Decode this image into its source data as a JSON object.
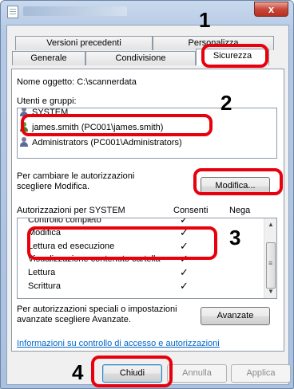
{
  "window": {
    "close_glyph": "x"
  },
  "tabs": {
    "back": [
      {
        "label": "Versioni precedenti"
      },
      {
        "label": "Personalizza"
      }
    ],
    "front": [
      {
        "label": "Generale"
      },
      {
        "label": "Condivisione"
      },
      {
        "label": "Sicurezza"
      }
    ]
  },
  "object_name": {
    "label": "Nome oggetto:",
    "value": "C:\\scannerdata"
  },
  "users_groups": {
    "label": "Utenti e gruppi:",
    "items": [
      {
        "label": "SYSTEM"
      },
      {
        "label": "james.smith (PC001\\james.smith)"
      },
      {
        "label": "Administrators (PC001\\Administrators)"
      }
    ]
  },
  "change_hint": {
    "line1": "Per cambiare le autorizzazioni",
    "line2": "scegliere Modifica."
  },
  "modify_button": "Modifica...",
  "permissions": {
    "header": "Autorizzazioni per SYSTEM",
    "allow_col": "Consenti",
    "deny_col": "Nega",
    "rows": [
      {
        "name": "Controllo completo",
        "allow": "✓"
      },
      {
        "name": "Modifica",
        "allow": "✓"
      },
      {
        "name": "Lettura ed esecuzione",
        "allow": "✓"
      },
      {
        "name": "Visualizzazione contenuto cartella",
        "allow": "✓"
      },
      {
        "name": "Lettura",
        "allow": "✓"
      },
      {
        "name": "Scrittura",
        "allow": "✓"
      }
    ]
  },
  "special_hint": {
    "line1": "Per autorizzazioni speciali o impostazioni",
    "line2": "avanzate scegliere Avanzate."
  },
  "advanced_button": "Avanzate",
  "info_link": "Informazioni su controllo di accesso e autorizzazioni",
  "footer_buttons": {
    "close": "Chiudi",
    "cancel": "Annulla",
    "apply": "Applica"
  },
  "callouts": {
    "step1": "1",
    "step2": "2",
    "step3": "3",
    "step4": "4"
  },
  "colors": {
    "callout": "#e8000d",
    "link": "#0066cc"
  }
}
